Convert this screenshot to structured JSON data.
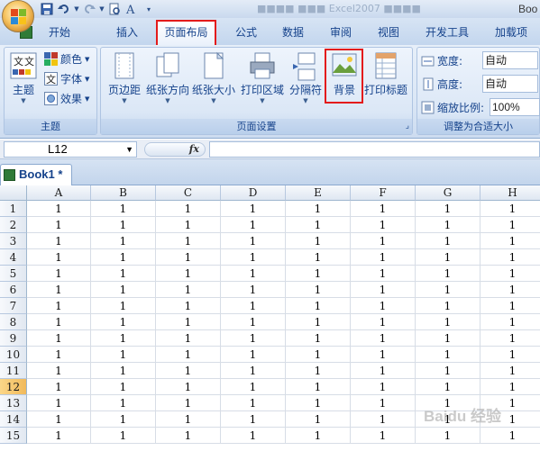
{
  "title": {
    "app_partial": "Boo",
    "blurred": "■■■■ ■■■ Excel2007 ■■■■"
  },
  "colors": {
    "highlight": "#e31b1b",
    "ribbon_text": "#15428b"
  },
  "qat": {
    "icons": [
      "save-icon",
      "undo-icon",
      "redo-icon",
      "print-preview-icon",
      "format-painter-icon",
      "customize-icon"
    ]
  },
  "tabs": [
    {
      "label": "开始"
    },
    {
      "label": "插入"
    },
    {
      "label": "页面布局",
      "active": true
    },
    {
      "label": "公式"
    },
    {
      "label": "数据"
    },
    {
      "label": "审阅"
    },
    {
      "label": "视图"
    },
    {
      "label": "开发工具"
    },
    {
      "label": "加载项"
    }
  ],
  "ribbon": {
    "theme_group": {
      "label": "主题",
      "themes_button": "主题",
      "colors": "颜色",
      "fonts": "字体",
      "effects": "效果"
    },
    "page_setup_group": {
      "label": "页面设置",
      "margins": "页边距",
      "orientation": "纸张方向",
      "size": "纸张大小",
      "print_area": "打印区域",
      "breaks": "分隔符",
      "background": "背景",
      "print_titles": "打印标题"
    },
    "scale_group": {
      "label": "调整为合适大小",
      "width_label": "宽度:",
      "width_value": "自动",
      "height_label": "高度:",
      "height_value": "自动",
      "scale_label": "缩放比例:",
      "scale_value": "100%"
    }
  },
  "formula_bar": {
    "name_box": "L12",
    "fx": "fx",
    "formula": ""
  },
  "workbook": {
    "tab_label": "Book1 *"
  },
  "sheet": {
    "columns": [
      "A",
      "B",
      "C",
      "D",
      "E",
      "F",
      "G",
      "H"
    ],
    "rows": [
      "1",
      "2",
      "3",
      "4",
      "5",
      "6",
      "7",
      "8",
      "9",
      "10",
      "11",
      "12",
      "13",
      "14",
      "15"
    ],
    "selected_row": "12",
    "cell_value": "1"
  },
  "watermark": "Baidu 经验"
}
